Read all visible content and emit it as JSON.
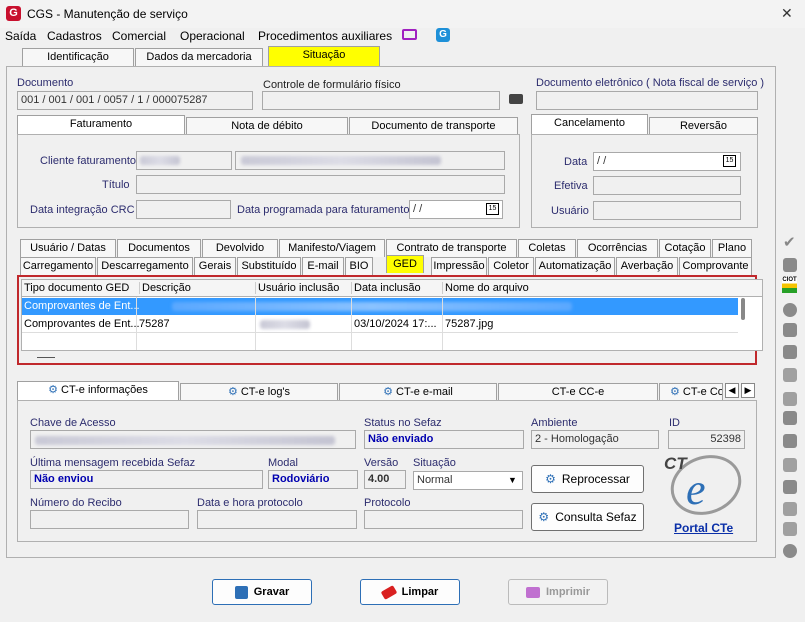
{
  "window": {
    "title": "CGS - Manutenção de serviço"
  },
  "menu": [
    "Saída",
    "Cadastros",
    "Comercial",
    "Operacional",
    "Procedimentos auxiliares"
  ],
  "top_tabs": [
    "Identificação",
    "Dados da mercadoria",
    "Situação"
  ],
  "documento": {
    "label": "Documento",
    "value": "001 / 001 / 001 / 0057 / 1 / 000075287",
    "controle_label": "Controle de formulário físico",
    "controle_value": "",
    "eletronico_label": "Documento eletrônico ( Nota fiscal de serviço )",
    "eletronico_value": ""
  },
  "fat_tabs": [
    "Faturamento",
    "Nota de débito",
    "Documento de transporte"
  ],
  "faturamento": {
    "cliente_label": "Cliente faturamento",
    "titulo_label": "Título",
    "crc_label": "Data integração CRC",
    "prog_label": "Data programada para faturamento",
    "prog_value": " /  /"
  },
  "cancel_tabs": [
    "Cancelamento",
    "Reversão"
  ],
  "cancelamento": {
    "data_label": "Data",
    "data_value": " /  /",
    "efetiva_label": "Efetiva",
    "usuario_label": "Usuário"
  },
  "tabs_row1": [
    "Usuário / Datas",
    "Documentos",
    "Devolvido",
    "Manifesto/Viagem",
    "Contrato de transporte",
    "Coletas",
    "Ocorrências",
    "Cotação",
    "Plano"
  ],
  "tabs_row2": [
    "Carregamento",
    "Descarregamento",
    "Gerais",
    "Substituído",
    "E-mail",
    "BIO",
    "GED",
    "Impressão",
    "Coletor",
    "Automatização",
    "Averbação",
    "Comprovante"
  ],
  "ged_table": {
    "columns": [
      "Tipo documento GED",
      "Descrição",
      "Usuário inclusão",
      "Data inclusão",
      "Nome do arquivo"
    ],
    "rows": [
      [
        "Comprovantes de Ent...",
        "",
        "",
        "",
        ""
      ],
      [
        "Comprovantes de Ent...",
        "75287",
        "",
        "03/10/2024 17:...",
        "75287.jpg"
      ]
    ]
  },
  "cte_tabs": [
    "CT-e informações",
    "CT-e log's",
    "CT-e e-mail",
    "CT-e CC-e",
    "CT-e Co"
  ],
  "cte": {
    "chave_label": "Chave de Acesso",
    "status_label": "Status no Sefaz",
    "status_value": "Não enviado",
    "ambiente_label": "Ambiente",
    "ambiente_value": "2 - Homologação",
    "id_label": "ID",
    "id_value": "52398",
    "msg_label": "Última mensagem recebida Sefaz",
    "msg_value": "Não enviou",
    "modal_label": "Modal",
    "modal_value": "Rodoviário",
    "versao_label": "Versão",
    "versao_value": "4.00",
    "situacao_label": "Situação",
    "situacao_value": "Normal",
    "reprocessar_label": "Reprocessar",
    "recibo_label": "Número do Recibo",
    "datahora_label": "Data e hora protocolo",
    "protocolo_label": "Protocolo",
    "consulta_label": "Consulta Sefaz",
    "portal_label": "Portal CTe",
    "logo_text": "CT"
  },
  "bottom": {
    "gravar": "Gravar",
    "limpar": "Limpar",
    "imprimir": "Imprimir"
  },
  "colors": {
    "accent": "#3399ff",
    "highlight": "#ffff00",
    "brand": "#c8102e",
    "red_box": "#c0282c"
  }
}
